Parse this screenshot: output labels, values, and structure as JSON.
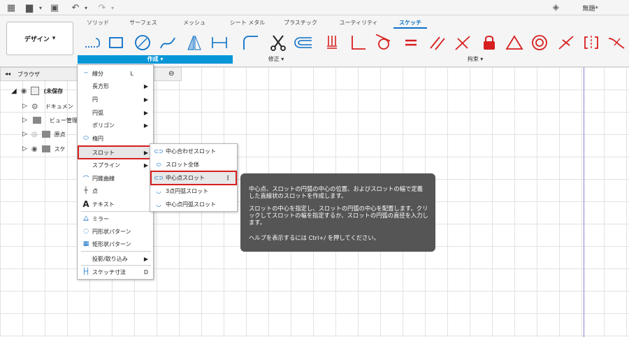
{
  "app": {
    "doc_title": "無題*"
  },
  "tabs": [
    {
      "label": "ソリッド"
    },
    {
      "label": "サーフェス"
    },
    {
      "label": "メッシュ"
    },
    {
      "label": "シート メタル"
    },
    {
      "label": "プラスチック"
    },
    {
      "label": "ユーティリティ"
    },
    {
      "label": "スケッチ"
    }
  ],
  "workspace": {
    "label": "デザイン"
  },
  "groups": {
    "create": "作成",
    "modify": "修正",
    "constrain": "拘束"
  },
  "browser": {
    "title": "ブラウザ",
    "rows": [
      {
        "label": "(未保存"
      },
      {
        "label": "ドキュメン"
      },
      {
        "label": "ビュー管理"
      },
      {
        "label": "原点"
      },
      {
        "label": "スケ"
      }
    ]
  },
  "menu": {
    "items": [
      {
        "label": "線分",
        "shortcut": "L"
      },
      {
        "label": "長方形"
      },
      {
        "label": "円"
      },
      {
        "label": "円弧"
      },
      {
        "label": "ポリゴン"
      },
      {
        "label": "楕円"
      },
      {
        "label": "スロット"
      },
      {
        "label": "スプライン"
      },
      {
        "label": "円錐曲線"
      },
      {
        "label": "点"
      },
      {
        "label": "テキスト"
      },
      {
        "label": "ミラー"
      },
      {
        "label": "円形状パターン"
      },
      {
        "label": "矩形状パターン"
      },
      {
        "label": "投影/取り込み"
      },
      {
        "label": "スケッチ寸法",
        "shortcut": "D"
      }
    ]
  },
  "submenu": {
    "items": [
      {
        "label": "中心合わせスロット"
      },
      {
        "label": "スロット全体"
      },
      {
        "label": "中心点スロット"
      },
      {
        "label": "3点円弧スロット"
      },
      {
        "label": "中心点円弧スロット"
      }
    ]
  },
  "tooltip": {
    "p1": "中心点、スロットの円弧の中心の位置、およびスロットの幅で定義した直線状のスロットを作成します。",
    "p2": "スロットの中心を指定し、スロットの円弧の中心を配置します。クリックしてスロットの幅を指定するか、スロットの円弧の直径を入力します。",
    "p3": "ヘルプを表示するには Ctrl+/ を押してください。"
  },
  "colors": {
    "accent": "#0696d7",
    "highlight": "#d71f1f",
    "constraint": "#d71f1f"
  }
}
